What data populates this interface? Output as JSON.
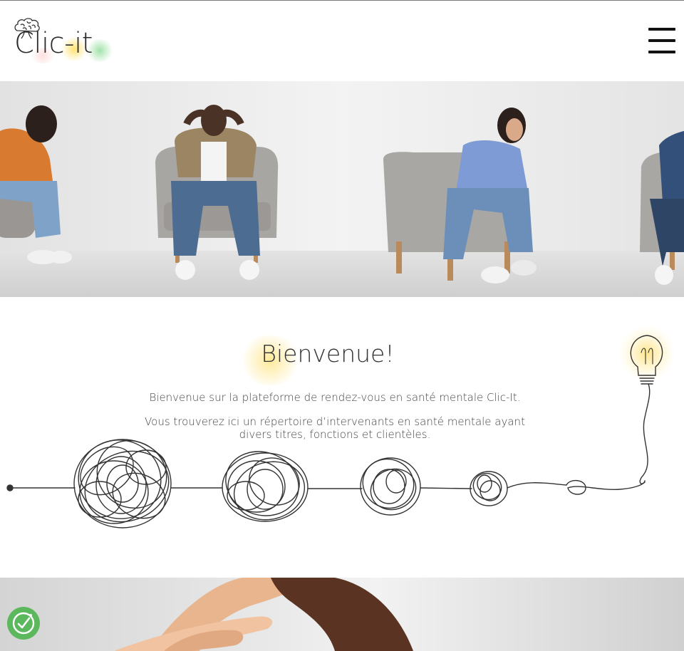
{
  "header": {
    "logo_text": "Clic-it",
    "menu_icon": "hamburger-menu-icon"
  },
  "hero": {
    "image_description_icon": "hero-photo"
  },
  "welcome": {
    "title": "Bienvenue!",
    "line1": "Bienvenue sur la plateforme de rendez-vous en santé mentale Clic-It.",
    "line2": "Vous trouverez ici un répertoire d’intervenants en santé mentale ayant divers titres, fonctions et clientèles."
  },
  "accessibility": {
    "icon": "accessibility-check-icon"
  },
  "colors": {
    "accent_yellow": "#ffe27a",
    "accent_green": "#5cb85c",
    "text_dark": "#333333"
  }
}
